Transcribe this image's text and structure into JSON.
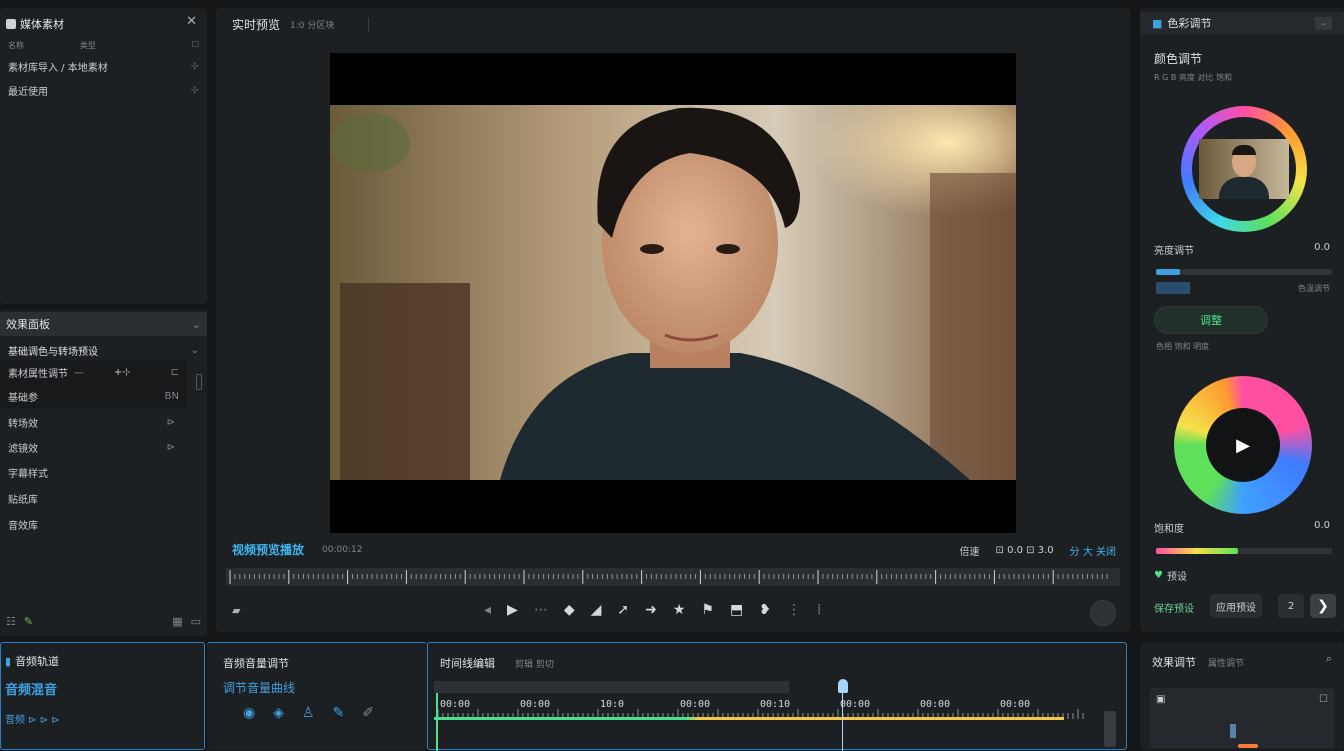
{
  "left_top": {
    "title": "媒体素材",
    "col1": "名称",
    "col2": "类型",
    "items": [
      {
        "label": "素材库导入 / 本地素材",
        "icon": "pin-icon"
      },
      {
        "label": "最近使用",
        "icon": "pin-icon"
      }
    ]
  },
  "left_mid": {
    "title": "效果面板",
    "group": "基础调色与转场预设",
    "items": [
      {
        "label": "素材属性调节",
        "value": "一",
        "mid": "+⊹",
        "end": "⊏"
      },
      {
        "label": "基础参",
        "value": "",
        "mid": "",
        "end": "BN"
      },
      {
        "label": "转场效",
        "value": "",
        "mid": "",
        "end": "⊳"
      },
      {
        "label": "滤镜效",
        "value": "",
        "mid": "",
        "end": "⊳"
      },
      {
        "label": "字幕样式",
        "value": "",
        "mid": "",
        "end": ""
      },
      {
        "label": "贴纸库",
        "value": "",
        "mid": "",
        "end": ""
      },
      {
        "label": "音效库",
        "value": "",
        "mid": "",
        "end": ""
      }
    ]
  },
  "viewer": {
    "title": "实时预览",
    "meta": "1:0  分区块",
    "caption": "视频预览播放",
    "caption_meta": "00:00:12",
    "right_label": "倍速",
    "right_meta": "⊡ 0.0 ⊡ 3.0",
    "right_meta2": "分 大 关闭"
  },
  "transport": {
    "buttons": [
      "mark-in-icon",
      "prev-frame-icon",
      "play-icon",
      "next-frame-icon",
      "marker-icon",
      "razor-icon",
      "pointer-icon",
      "forward-icon",
      "star-icon",
      "flag-icon",
      "export-icon",
      "heart-icon",
      "more-icon",
      "settings-icon"
    ]
  },
  "right_panel": {
    "title": "色彩调节",
    "section1": "颜色调节",
    "section1_sub": "R  G  B  亮度  对比  饱和",
    "slider1_label": "亮度调节",
    "slider1_value": "0.0",
    "slider1_sub": "色温调节",
    "toggle_label": "调整",
    "toggle_sub": "色相  饱和  明度",
    "slider2_label": "饱和度",
    "slider2_value": "0.0",
    "status_label": "预设",
    "footer_left": "保存预设",
    "footer_button": "应用预设",
    "footer_num": "2"
  },
  "bottom_left": {
    "title": "音频轨道",
    "subtitle": "音频混音",
    "tools": "音频  ⊳  ⊳  ⊳"
  },
  "bottom_mid": {
    "title": "音频音量调节",
    "subtitle": "调节音量曲线"
  },
  "timeline": {
    "title": "时间线编辑",
    "sub": "剪辑  剪切",
    "ticks": [
      "00:00",
      "00:00",
      "10:0",
      "00:00",
      "00:10",
      "00:00",
      "00:00",
      "00:00"
    ]
  },
  "bottom_right": {
    "title": "效果调节",
    "sub": "属性调节"
  }
}
